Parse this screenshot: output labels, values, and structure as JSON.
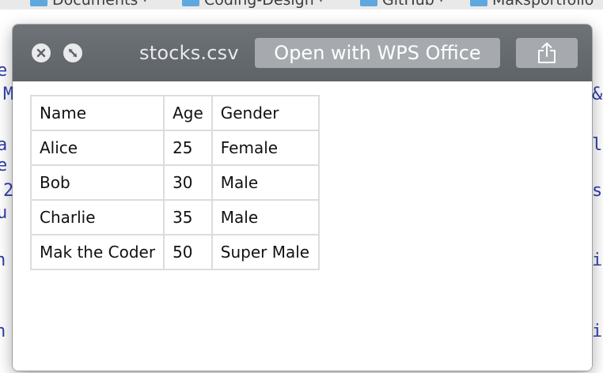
{
  "bookmarks": [
    {
      "label": "Documents"
    },
    {
      "label": "Coding-Design"
    },
    {
      "label": "GitHub"
    },
    {
      "label": "Maksportfolio"
    }
  ],
  "window": {
    "title": "stocks.csv",
    "open_with_label": "Open with WPS Office"
  },
  "table": {
    "rows": [
      [
        "Name",
        "Age",
        "Gender"
      ],
      [
        "Alice",
        "25",
        "Female"
      ],
      [
        "Bob",
        "30",
        "Male"
      ],
      [
        "Charlie",
        "35",
        "Male"
      ],
      [
        "Mak the Coder",
        "50",
        "Super Male"
      ]
    ]
  }
}
